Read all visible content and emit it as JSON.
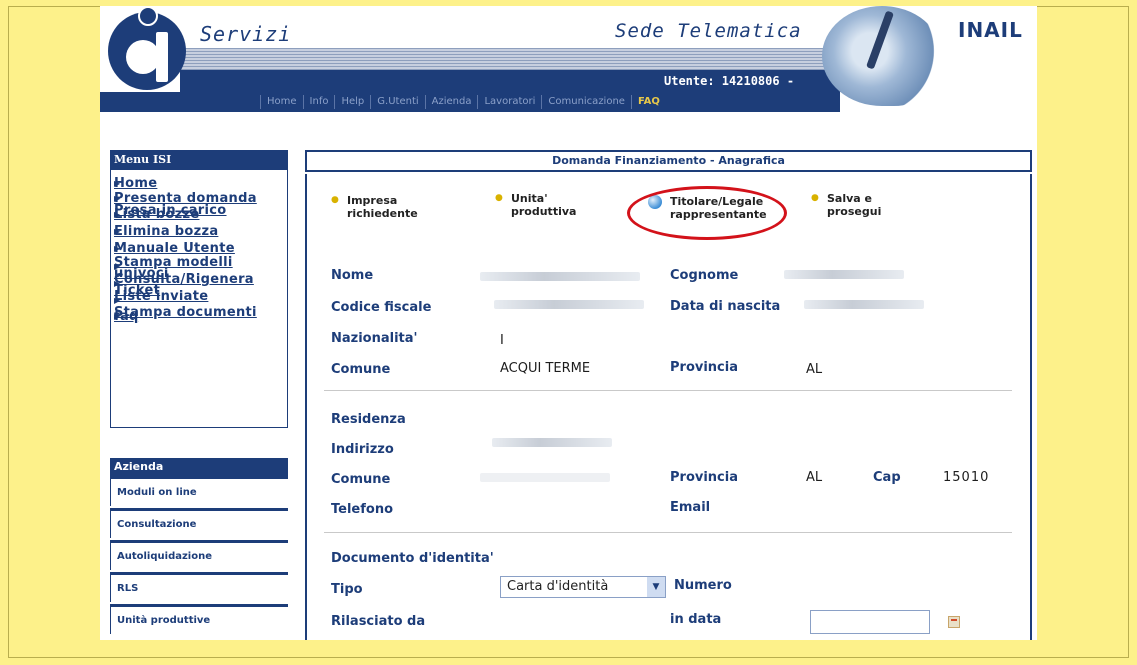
{
  "header": {
    "servizi": "Servizi",
    "sede": "Sede Telematica",
    "brand": "INAIL",
    "user": "Utente: 14210806 -",
    "nav": [
      "Home",
      "Info",
      "Help",
      "G.Utenti",
      "Azienda",
      "Lavoratori",
      "Comunicazione",
      "FAQ"
    ],
    "nav_active": "FAQ"
  },
  "sidebar": {
    "menu_title": "Menu ISI",
    "items": [
      {
        "label": "Home"
      },
      {
        "label": "Presenta domanda"
      },
      {
        "label": "Presa in carico"
      },
      {
        "label": "Lista bozze"
      },
      {
        "label": "Elimina bozza"
      },
      {
        "label": "Manuale Utente"
      },
      {
        "label": "Stampa modelli univoci"
      },
      {
        "label": "Consulta/Rigenera Ticket"
      },
      {
        "label": "Liste inviate"
      },
      {
        "label": "Stampa documenti"
      },
      {
        "label": "faq"
      }
    ],
    "azienda_title": "Azienda",
    "azienda_items": [
      "Moduli on line",
      "Consultazione",
      "Autoliquidazione",
      "RLS",
      "Unità produttive"
    ]
  },
  "main": {
    "title": "Domanda Finanziamento - Anagrafica",
    "steps": [
      {
        "line1": "Impresa",
        "line2": "richiedente"
      },
      {
        "line1": "Unita'",
        "line2": "produttiva"
      },
      {
        "line1": "Titolare/Legale",
        "line2": "rappresentante"
      },
      {
        "line1": "Salva e",
        "line2": "prosegui"
      }
    ],
    "active_step": 2,
    "fields": {
      "nome_label": "Nome",
      "cognome_label": "Cognome",
      "cf_label": "Codice fiscale",
      "nascita_label": "Data di nascita",
      "nazionalita_label": "Nazionalita'",
      "nazionalita_value": "I",
      "comune_label": "Comune",
      "comune_value": "ACQUI TERME",
      "provincia_label": "Provincia",
      "provincia_value": "AL",
      "residenza_label": "Residenza",
      "indirizzo_label": "Indirizzo",
      "comune2_label": "Comune",
      "provincia2_label": "Provincia",
      "provincia2_value": "AL",
      "cap_label": "Cap",
      "cap_value": "15010",
      "telefono_label": "Telefono",
      "email_label": "Email",
      "documento_label": "Documento d'identita'",
      "tipo_label": "Tipo",
      "tipo_value": "Carta d'identità",
      "numero_label": "Numero",
      "rilasciato_label": "Rilasciato da",
      "in_data_label": "in data"
    }
  },
  "colors": {
    "navy": "#1d3d79",
    "background": "#fdf18a",
    "highlight": "#d3121a"
  }
}
